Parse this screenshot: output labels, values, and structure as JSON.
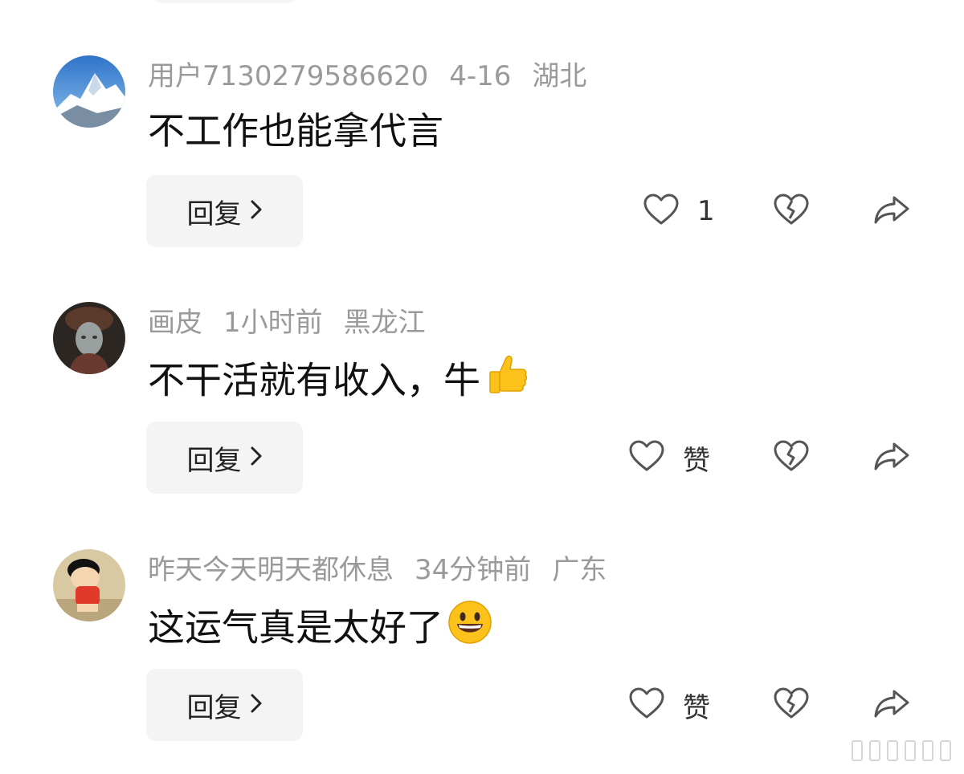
{
  "comments": [
    {
      "username": "用户7130279586620",
      "time": "4-16",
      "location": "湖北",
      "content": "不工作也能拿代言",
      "reply_label": "回复",
      "like_text": "1",
      "avatar": "snowy-mountain"
    },
    {
      "username": "画皮",
      "time": "1小时前",
      "location": "黑龙江",
      "content": "不干活就有收入，牛",
      "content_emoji": "thumbs-up-emoji",
      "reply_label": "回复",
      "like_text": "赞",
      "avatar": "dark-portrait"
    },
    {
      "username": "昨天今天明天都休息",
      "time": "34分钟前",
      "location": "广东",
      "content": "这运气真是太好了",
      "content_emoji": "grinning-face-emoji",
      "reply_label": "回复",
      "like_text": "赞",
      "avatar": "cartoon-boy"
    }
  ],
  "icons": {
    "like": "heart-outline-icon",
    "dislike": "broken-heart-icon",
    "share": "share-arrow-icon",
    "reply_chevron": "chevron-right-icon"
  },
  "colors": {
    "meta_text": "#9a9a9a",
    "content_text": "#111111",
    "button_bg": "#f4f4f4",
    "icon_stroke": "#555555"
  }
}
